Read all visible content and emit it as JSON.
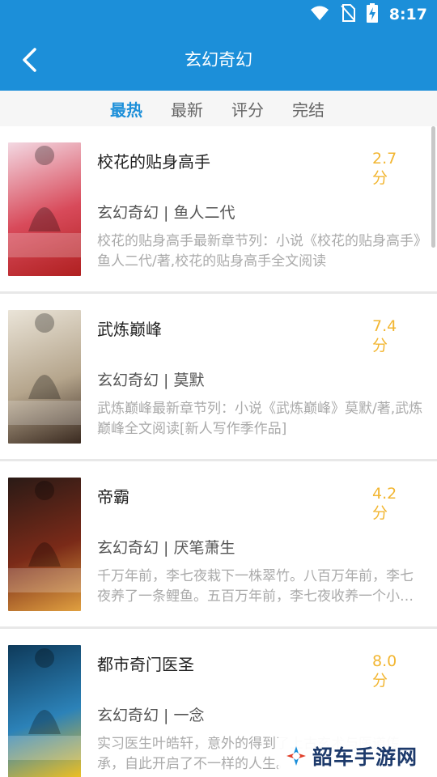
{
  "status": {
    "time": "8:17"
  },
  "header": {
    "title": "玄幻奇幻"
  },
  "tabs": [
    {
      "label": "最热",
      "active": true
    },
    {
      "label": "最新",
      "active": false
    },
    {
      "label": "评分",
      "active": false
    },
    {
      "label": "完结",
      "active": false
    }
  ],
  "books": [
    {
      "title": "校花的贴身高手",
      "score": "2.7分",
      "category": "玄幻奇幻",
      "author": "鱼人二代",
      "meta": "玄幻奇幻 | 鱼人二代",
      "desc": "校花的贴身高手最新章节列：小说《校花的贴身高手》鱼人二代/著,校花的贴身高手全文阅读",
      "cover_title": "校花的贴身高手",
      "cover_colors": [
        "#f3d8e2",
        "#d84a5a",
        "#b02020"
      ]
    },
    {
      "title": "武炼巅峰",
      "score": "7.4分",
      "category": "玄幻奇幻",
      "author": "莫默",
      "meta": "玄幻奇幻 | 莫默",
      "desc": "武炼巅峰最新章节列：小说《武炼巅峰》莫默/著,武炼巅峰全文阅读[新人写作季作品]",
      "cover_title": "武炼巅峰",
      "cover_colors": [
        "#eae4d8",
        "#b5a58c",
        "#3a2a20"
      ]
    },
    {
      "title": "帝霸",
      "score": "4.2分",
      "category": "玄幻奇幻",
      "author": "厌笔萧生",
      "meta": "玄幻奇幻 | 厌笔萧生",
      "desc": "千万年前，李七夜栽下一株翠竹。八百万年前，李七夜养了一条鲤鱼。五百万年前，李七夜收养一个小女孩。",
      "cover_title": "帝霸",
      "cover_colors": [
        "#2a1a16",
        "#7a2a18",
        "#e0a040"
      ]
    },
    {
      "title": "都市奇门医圣",
      "score": "8.0分",
      "category": "玄幻奇幻",
      "author": "一念",
      "meta": "玄幻奇幻 | 一念",
      "desc": "实习医生叶皓轩，意外的得到了上古玄术与医道传承，自此开启了不一样的人生。",
      "cover_title": "都市奇门医圣",
      "cover_colors": [
        "#0e3a5a",
        "#2c82b8",
        "#f0c020"
      ]
    }
  ],
  "watermark": {
    "text": "韶车手游网"
  },
  "colors": {
    "primary": "#1c8fd9",
    "score": "#f2b632"
  }
}
